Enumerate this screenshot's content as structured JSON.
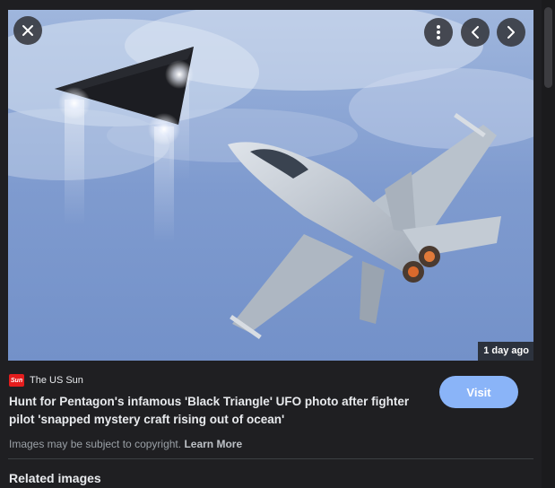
{
  "viewer": {
    "close_icon": "close-icon",
    "more_icon": "more-vert-icon",
    "prev_icon": "chevron-left-icon",
    "next_icon": "chevron-right-icon",
    "age_badge": "1 day ago"
  },
  "result": {
    "source_name": "The US Sun",
    "favicon_text": "Sun",
    "favicon_color": "#e41d1d",
    "title": "Hunt for Pentagon's infamous 'Black Triangle' UFO photo after fighter pilot 'snapped mystery craft rising out of ocean'",
    "visit_label": "Visit",
    "copyright_text": "Images may be subject to copyright.",
    "learn_more_label": "Learn More"
  },
  "related": {
    "heading": "Related images"
  },
  "colors": {
    "accent": "#8ab4f8",
    "background": "#1f1f22"
  }
}
